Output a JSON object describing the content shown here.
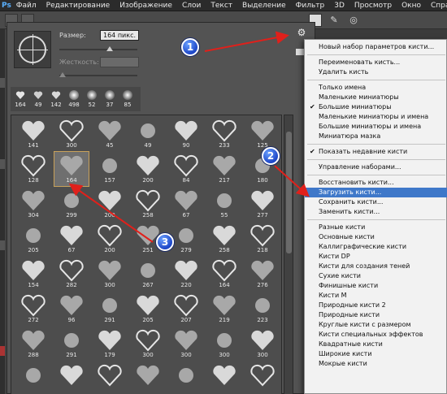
{
  "app": {
    "logo": "Ps"
  },
  "menubar": [
    "Файл",
    "Редактирование",
    "Изображение",
    "Слои",
    "Текст",
    "Выделение",
    "Фильтр",
    "3D",
    "Просмотр",
    "Окно",
    "Справка"
  ],
  "panel": {
    "size_label": "Размер:",
    "size_value": "164 пикс.",
    "hardness_label": "Жесткость:",
    "hardness_value": ""
  },
  "recent_brushes": [
    "164",
    "49",
    "142",
    "498",
    "52",
    "37",
    "85"
  ],
  "brush_rows": [
    [
      "141",
      "300",
      "45",
      "49",
      "90",
      "233",
      "125"
    ],
    [
      "128",
      "164",
      "157",
      "200",
      "84",
      "217",
      "180"
    ],
    [
      "304",
      "299",
      "200",
      "258",
      "67",
      "55",
      "277"
    ],
    [
      "205",
      "67",
      "200",
      "251",
      "279",
      "258",
      "218"
    ],
    [
      "154",
      "282",
      "300",
      "267",
      "220",
      "164",
      "276"
    ],
    [
      "272",
      "96",
      "291",
      "205",
      "207",
      "219",
      "223"
    ],
    [
      "288",
      "291",
      "179",
      "300",
      "300",
      "300",
      "300"
    ],
    [
      "",
      "",
      "",
      "",
      "",
      "",
      ""
    ]
  ],
  "menu": {
    "items": [
      {
        "label": "Новый набор параметров кисти...",
        "check": false,
        "sep_after": true
      },
      {
        "label": "Переименовать кисть...",
        "check": false
      },
      {
        "label": "Удалить кисть",
        "check": false,
        "sep_after": true
      },
      {
        "label": "Только имена",
        "check": false
      },
      {
        "label": "Маленькие миниатюры",
        "check": false
      },
      {
        "label": "Большие миниатюры",
        "check": true
      },
      {
        "label": "Маленькие миниатюры и имена",
        "check": false
      },
      {
        "label": "Большие миниатюры и имена",
        "check": false
      },
      {
        "label": "Миниатюра мазка",
        "check": false,
        "sep_after": true
      },
      {
        "label": "Показать недавние кисти",
        "check": true,
        "sep_after": true
      },
      {
        "label": "Управление наборами...",
        "check": false,
        "sep_after": true
      },
      {
        "label": "Восстановить кисти...",
        "check": false
      },
      {
        "label": "Загрузить кисти...",
        "check": false,
        "highlighted": true
      },
      {
        "label": "Сохранить кисти...",
        "check": false
      },
      {
        "label": "Заменить кисти...",
        "check": false,
        "sep_after": true
      },
      {
        "label": "Разные кисти",
        "check": false
      },
      {
        "label": "Основные кисти",
        "check": false
      },
      {
        "label": "Каллиграфические кисти",
        "check": false
      },
      {
        "label": "Кисти DP",
        "check": false
      },
      {
        "label": "Кисти для создания теней",
        "check": false
      },
      {
        "label": "Сухие кисти",
        "check": false
      },
      {
        "label": "Финишные кисти",
        "check": false
      },
      {
        "label": "Кисти M",
        "check": false
      },
      {
        "label": "Природные кисти 2",
        "check": false
      },
      {
        "label": "Природные кисти",
        "check": false
      },
      {
        "label": "Круглые кисти с размером",
        "check": false
      },
      {
        "label": "Кисти специальных эффектов",
        "check": false
      },
      {
        "label": "Квадратные кисти",
        "check": false
      },
      {
        "label": "Широкие кисти",
        "check": false
      },
      {
        "label": "Мокрые кисти",
        "check": false
      }
    ]
  },
  "callouts": [
    "1",
    "2",
    "3"
  ],
  "colors": {
    "highlight": "#3f78c9",
    "badge": "#1d46c7",
    "arrow": "#e0201b"
  }
}
